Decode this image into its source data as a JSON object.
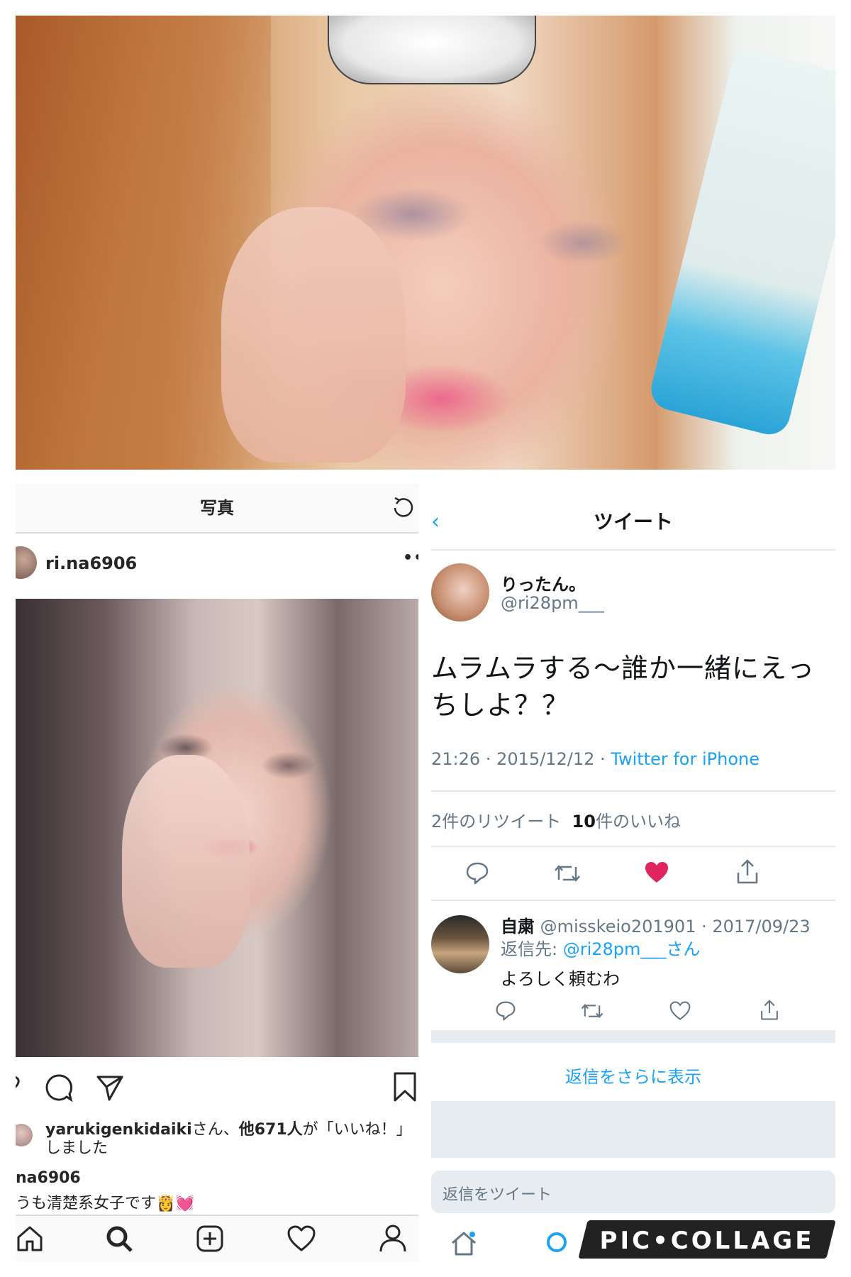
{
  "instagram": {
    "header_title": "写真",
    "username": "ri.na6906",
    "more": "••",
    "likes_user": "yarukigenkidaiki",
    "likes_suffix": "さん、",
    "likes_others": "他671人",
    "likes_tail": "が「いいね！」しました",
    "caption_user": "na6906",
    "caption_text": "うも清楚系女子です👸💓",
    "icons": [
      "refresh-icon",
      "heart-icon",
      "comment-icon",
      "share-icon",
      "bookmark-icon",
      "home-icon",
      "search-icon",
      "add-icon",
      "activity-icon",
      "profile-icon"
    ]
  },
  "twitter": {
    "back": "‹",
    "title": "ツイート",
    "name": "りったん。",
    "handle": "@ri28pm___",
    "text": "ムラムラする〜誰か一緒にえっちしよ？？",
    "time": "21:26 · 2015/12/12 · ",
    "client": "Twitter for iPhone",
    "retweets_count": "2",
    "retweets_label": "件のリツイート",
    "likes_count": "10",
    "likes_label": "件のいいね",
    "reply": {
      "name": "自粛",
      "handle_date": " @misskeio201901 · 2017/09/23",
      "reply_to_label": "返信先: ",
      "reply_to_user": "@ri28pm___さん",
      "text": "よろしく頼むわ"
    },
    "more_replies": "返信をさらに表示",
    "reply_placeholder": "返信をツイート",
    "like_color": "#e0245e",
    "link_color": "#1da1f2",
    "icons": [
      "reply-icon",
      "retweet-icon",
      "like-icon",
      "share-icon",
      "home-icon",
      "explore-icon",
      "notifications-icon",
      "messages-icon"
    ]
  },
  "watermark": "PIC•COLLAGE"
}
